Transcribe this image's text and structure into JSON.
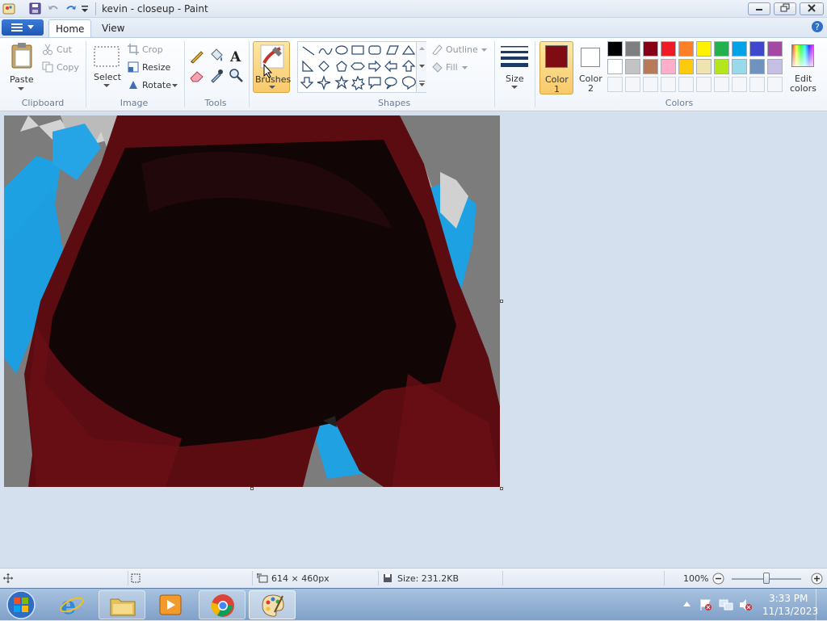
{
  "window": {
    "title": "kevin - closeup - Paint"
  },
  "tabs": {
    "file": "",
    "home": "Home",
    "view": "View"
  },
  "clipboard": {
    "paste": "Paste",
    "cut": "Cut",
    "copy": "Copy",
    "group": "Clipboard"
  },
  "image": {
    "select": "Select",
    "crop": "Crop",
    "resize": "Resize",
    "rotate": "Rotate",
    "group": "Image"
  },
  "tools": {
    "group": "Tools"
  },
  "brushes": {
    "label": "Brushes"
  },
  "shapes": {
    "outline": "Outline",
    "fill": "Fill",
    "group": "Shapes"
  },
  "size": {
    "label": "Size"
  },
  "colors": {
    "color1_label": "Color",
    "color1_num": "1",
    "color2_label": "Color",
    "color2_num": "2",
    "edit_label": "Edit",
    "edit_label2": "colors",
    "group": "Colors",
    "color1": "#7f0c12",
    "color2": "#ffffff",
    "palette_row1": [
      "#000000",
      "#7f7f7f",
      "#880015",
      "#ed1c24",
      "#ff7f27",
      "#fff200",
      "#22b14c",
      "#00a2e8",
      "#3f48cc",
      "#a349a4"
    ],
    "palette_row2": [
      "#ffffff",
      "#c3c3c3",
      "#b97a57",
      "#ffaec9",
      "#ffc90e",
      "#efe4b0",
      "#b5e61d",
      "#99d9ea",
      "#7092be",
      "#c8bfe7"
    ]
  },
  "status": {
    "dimensions": "614 × 460px",
    "size": "Size: 231.2KB",
    "zoom": "100%",
    "zoom_fraction": 0.5
  },
  "taskbar": {
    "time": "3:33 PM",
    "date": "11/13/2023"
  }
}
